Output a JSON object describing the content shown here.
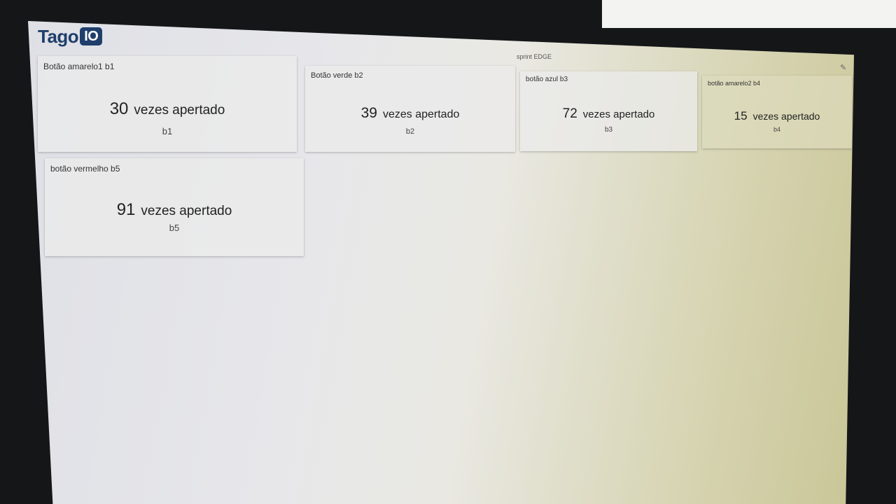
{
  "app": {
    "logo_text": "Tago",
    "logo_badge": "IO",
    "dashboard_title": "sprint EDGE"
  },
  "widgets": [
    {
      "title": "Botão amarelo1 b1",
      "value": "30",
      "unit": "vezes apertado",
      "variable": "b1"
    },
    {
      "title": "Botão verde b2",
      "value": "39",
      "unit": "vezes apertado",
      "variable": "b2"
    },
    {
      "title": "botão azul b3",
      "value": "72",
      "unit": "vezes apertado",
      "variable": "b3"
    },
    {
      "title": "botão amarelo2 b4",
      "value": "15",
      "unit": "vezes apertado",
      "variable": "b4"
    },
    {
      "title": "botão vermelho b5",
      "value": "91",
      "unit": "vezes apertado",
      "variable": "b5"
    }
  ],
  "icons": {
    "pin": "pin-icon"
  }
}
